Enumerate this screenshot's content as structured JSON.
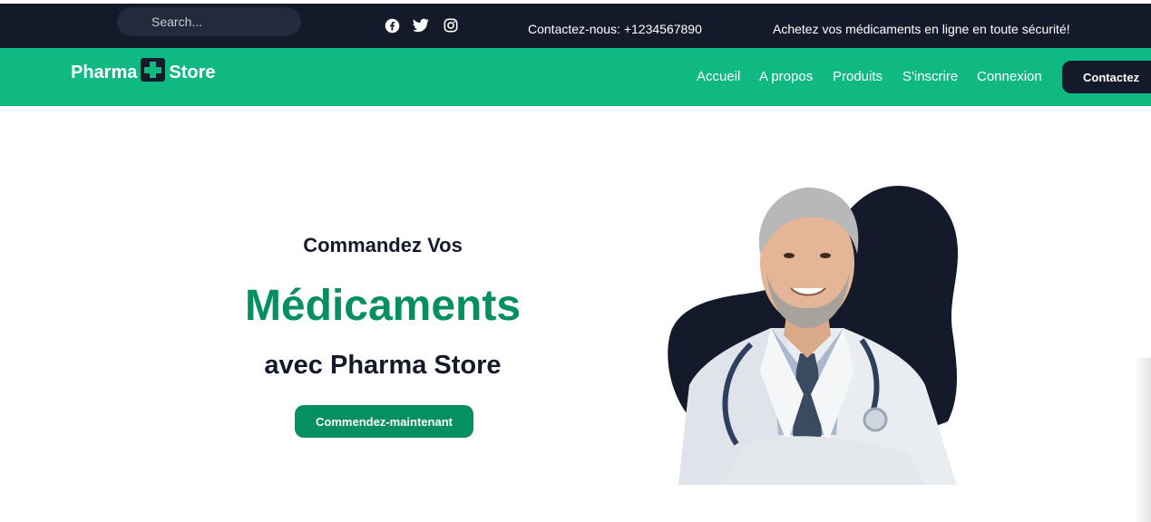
{
  "topbar": {
    "search_placeholder": "Search...",
    "social": [
      "facebook-icon",
      "twitter-icon",
      "instagram-icon"
    ],
    "contact_text": "Contactez-nous: +1234567890",
    "promo_text": "Achetez vos médicaments en ligne en toute sécurité!"
  },
  "navbar": {
    "logo_left": "Pharma",
    "logo_right": "Store",
    "links": [
      "Accueil",
      "A propos",
      "Produits",
      "S'inscrire",
      "Connexion"
    ],
    "contact_button": "Contactez"
  },
  "hero": {
    "line1": "Commandez Vos",
    "line2": "Médicaments",
    "line3": "avec Pharma Store",
    "cta": "Commendez-maintenant",
    "image": "doctor-portrait"
  },
  "colors": {
    "dark": "#141a29",
    "green": "#10b981",
    "deep_green": "#068f5f",
    "white": "#ffffff"
  }
}
